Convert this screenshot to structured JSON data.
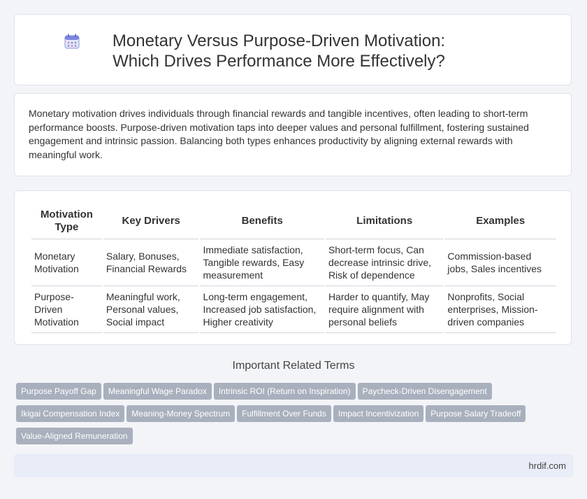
{
  "header": {
    "title": "Monetary Versus Purpose-Driven Motivation: Which Drives Performance More Effectively?",
    "icon": "calendar-icon"
  },
  "intro": {
    "text": "Monetary motivation drives individuals through financial rewards and tangible incentives, often leading to short-term performance boosts. Purpose-driven motivation taps into deeper values and personal fulfillment, fostering sustained engagement and intrinsic passion. Balancing both types enhances productivity by aligning external rewards with meaningful work."
  },
  "table": {
    "headers": [
      "Motivation Type",
      "Key Drivers",
      "Benefits",
      "Limitations",
      "Examples"
    ],
    "rows": [
      [
        "Monetary Motivation",
        "Salary, Bonuses, Financial Rewards",
        "Immediate satisfaction, Tangible rewards, Easy measurement",
        "Short-term focus, Can decrease intrinsic drive, Risk of dependence",
        "Commission-based jobs, Sales incentives"
      ],
      [
        "Purpose-Driven Motivation",
        "Meaningful work, Personal values, Social impact",
        "Long-term engagement, Increased job satisfaction, Higher creativity",
        "Harder to quantify, May require alignment with personal beliefs",
        "Nonprofits, Social enterprises, Mission-driven companies"
      ]
    ]
  },
  "related": {
    "title": "Important Related Terms",
    "tags": [
      "Purpose Payoff Gap",
      "Meaningful Wage Paradox",
      "Intrinsic ROI (Return on Inspiration)",
      "Paycheck-Driven Disengagement",
      "Ikigai Compensation Index",
      "Meaning-Money Spectrum",
      "Fulfillment Over Funds",
      "Impact Incentivization",
      "Purpose Salary Tradeoff",
      "Value-Aligned Remuneration"
    ]
  },
  "footer": {
    "site": "hrdif.com"
  },
  "colors": {
    "tag_bg": "#a9b0bd",
    "footer_bg": "#e8edf8",
    "page_bg": "#f3f4f8"
  }
}
